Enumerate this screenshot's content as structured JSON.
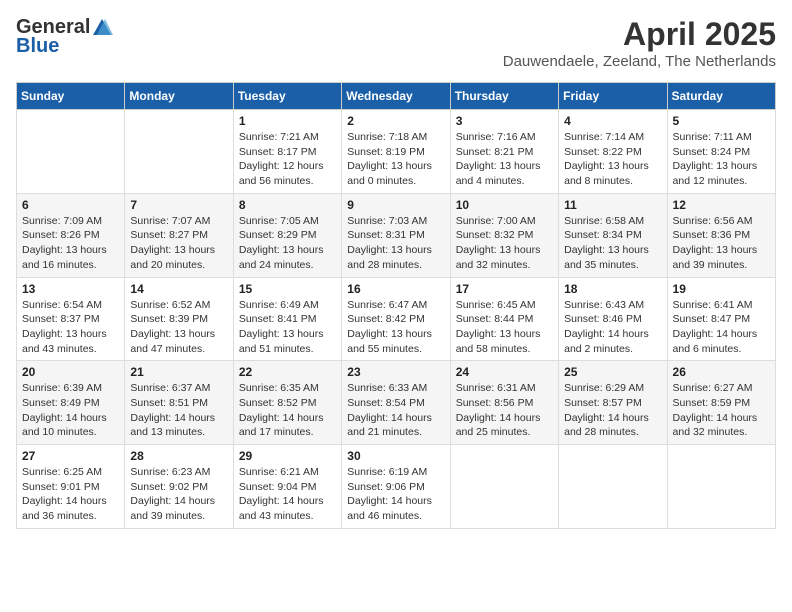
{
  "header": {
    "logo_general": "General",
    "logo_blue": "Blue",
    "month": "April 2025",
    "location": "Dauwendaele, Zeeland, The Netherlands"
  },
  "days_of_week": [
    "Sunday",
    "Monday",
    "Tuesday",
    "Wednesday",
    "Thursday",
    "Friday",
    "Saturday"
  ],
  "weeks": [
    [
      {
        "day": "",
        "detail": ""
      },
      {
        "day": "",
        "detail": ""
      },
      {
        "day": "1",
        "detail": "Sunrise: 7:21 AM\nSunset: 8:17 PM\nDaylight: 12 hours and 56 minutes."
      },
      {
        "day": "2",
        "detail": "Sunrise: 7:18 AM\nSunset: 8:19 PM\nDaylight: 13 hours and 0 minutes."
      },
      {
        "day": "3",
        "detail": "Sunrise: 7:16 AM\nSunset: 8:21 PM\nDaylight: 13 hours and 4 minutes."
      },
      {
        "day": "4",
        "detail": "Sunrise: 7:14 AM\nSunset: 8:22 PM\nDaylight: 13 hours and 8 minutes."
      },
      {
        "day": "5",
        "detail": "Sunrise: 7:11 AM\nSunset: 8:24 PM\nDaylight: 13 hours and 12 minutes."
      }
    ],
    [
      {
        "day": "6",
        "detail": "Sunrise: 7:09 AM\nSunset: 8:26 PM\nDaylight: 13 hours and 16 minutes."
      },
      {
        "day": "7",
        "detail": "Sunrise: 7:07 AM\nSunset: 8:27 PM\nDaylight: 13 hours and 20 minutes."
      },
      {
        "day": "8",
        "detail": "Sunrise: 7:05 AM\nSunset: 8:29 PM\nDaylight: 13 hours and 24 minutes."
      },
      {
        "day": "9",
        "detail": "Sunrise: 7:03 AM\nSunset: 8:31 PM\nDaylight: 13 hours and 28 minutes."
      },
      {
        "day": "10",
        "detail": "Sunrise: 7:00 AM\nSunset: 8:32 PM\nDaylight: 13 hours and 32 minutes."
      },
      {
        "day": "11",
        "detail": "Sunrise: 6:58 AM\nSunset: 8:34 PM\nDaylight: 13 hours and 35 minutes."
      },
      {
        "day": "12",
        "detail": "Sunrise: 6:56 AM\nSunset: 8:36 PM\nDaylight: 13 hours and 39 minutes."
      }
    ],
    [
      {
        "day": "13",
        "detail": "Sunrise: 6:54 AM\nSunset: 8:37 PM\nDaylight: 13 hours and 43 minutes."
      },
      {
        "day": "14",
        "detail": "Sunrise: 6:52 AM\nSunset: 8:39 PM\nDaylight: 13 hours and 47 minutes."
      },
      {
        "day": "15",
        "detail": "Sunrise: 6:49 AM\nSunset: 8:41 PM\nDaylight: 13 hours and 51 minutes."
      },
      {
        "day": "16",
        "detail": "Sunrise: 6:47 AM\nSunset: 8:42 PM\nDaylight: 13 hours and 55 minutes."
      },
      {
        "day": "17",
        "detail": "Sunrise: 6:45 AM\nSunset: 8:44 PM\nDaylight: 13 hours and 58 minutes."
      },
      {
        "day": "18",
        "detail": "Sunrise: 6:43 AM\nSunset: 8:46 PM\nDaylight: 14 hours and 2 minutes."
      },
      {
        "day": "19",
        "detail": "Sunrise: 6:41 AM\nSunset: 8:47 PM\nDaylight: 14 hours and 6 minutes."
      }
    ],
    [
      {
        "day": "20",
        "detail": "Sunrise: 6:39 AM\nSunset: 8:49 PM\nDaylight: 14 hours and 10 minutes."
      },
      {
        "day": "21",
        "detail": "Sunrise: 6:37 AM\nSunset: 8:51 PM\nDaylight: 14 hours and 13 minutes."
      },
      {
        "day": "22",
        "detail": "Sunrise: 6:35 AM\nSunset: 8:52 PM\nDaylight: 14 hours and 17 minutes."
      },
      {
        "day": "23",
        "detail": "Sunrise: 6:33 AM\nSunset: 8:54 PM\nDaylight: 14 hours and 21 minutes."
      },
      {
        "day": "24",
        "detail": "Sunrise: 6:31 AM\nSunset: 8:56 PM\nDaylight: 14 hours and 25 minutes."
      },
      {
        "day": "25",
        "detail": "Sunrise: 6:29 AM\nSunset: 8:57 PM\nDaylight: 14 hours and 28 minutes."
      },
      {
        "day": "26",
        "detail": "Sunrise: 6:27 AM\nSunset: 8:59 PM\nDaylight: 14 hours and 32 minutes."
      }
    ],
    [
      {
        "day": "27",
        "detail": "Sunrise: 6:25 AM\nSunset: 9:01 PM\nDaylight: 14 hours and 36 minutes."
      },
      {
        "day": "28",
        "detail": "Sunrise: 6:23 AM\nSunset: 9:02 PM\nDaylight: 14 hours and 39 minutes."
      },
      {
        "day": "29",
        "detail": "Sunrise: 6:21 AM\nSunset: 9:04 PM\nDaylight: 14 hours and 43 minutes."
      },
      {
        "day": "30",
        "detail": "Sunrise: 6:19 AM\nSunset: 9:06 PM\nDaylight: 14 hours and 46 minutes."
      },
      {
        "day": "",
        "detail": ""
      },
      {
        "day": "",
        "detail": ""
      },
      {
        "day": "",
        "detail": ""
      }
    ]
  ]
}
